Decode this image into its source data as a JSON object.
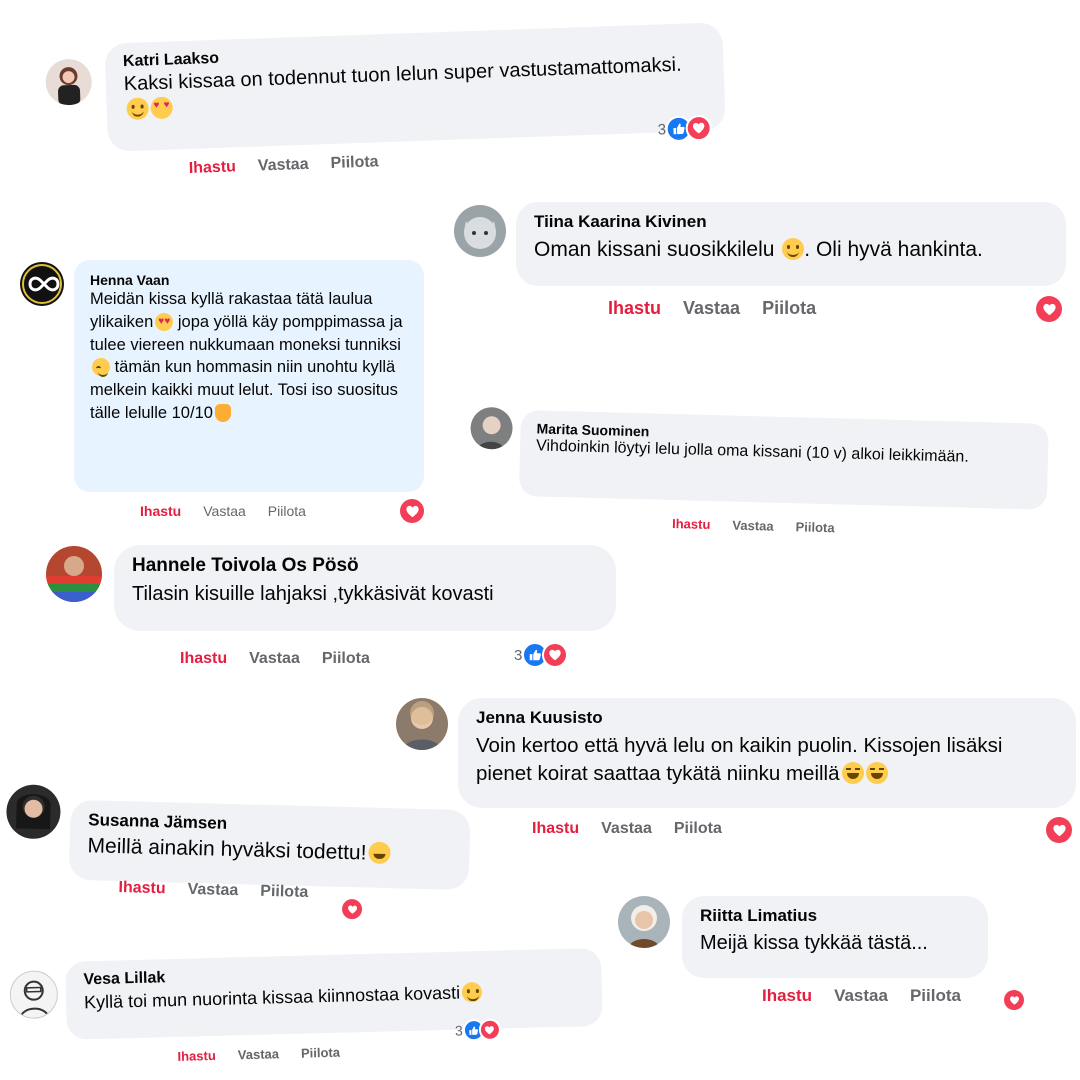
{
  "ui": {
    "like_label": "Ihastu",
    "reply_label": "Vastaa",
    "hide_label": "Piilota"
  },
  "comments": [
    {
      "author": "Katri Laakso",
      "text": "Kaksi kissaa on todennut tuon lelun super vastustamattomaksi.",
      "reaction_count": "3"
    },
    {
      "author": "Tiina Kaarina Kivinen",
      "text_before": "Oman kissani suosikkilelu",
      "text_after": ". Oli hyvä hankinta."
    },
    {
      "author": "Henna Vaan",
      "text": "Meidän kissa kyllä rakastaa tätä laulua ylikaiken",
      "text_2": " jopa yöllä käy pomppimassa ja tulee viereen nukkumaan moneksi tunniksi",
      "text_3": " tämän kun hommasin niin unohtu kyllä melkein kaikki muut lelut. Tosi iso suositus tälle lelulle 10/10"
    },
    {
      "author": "Marita Suominen",
      "text": "Vihdoinkin löytyi lelu jolla oma kissani (10 v) alkoi leikkimään."
    },
    {
      "author": "Hannele Toivola Os Pösö",
      "text": "Tilasin kisuille lahjaksi ,tykkäsivät kovasti",
      "reaction_count": "3"
    },
    {
      "author": "Jenna Kuusisto",
      "text": "Voin kertoo että hyvä lelu on kaikin puolin. Kissojen lisäksi pienet koirat saattaa tykätä niinku meillä"
    },
    {
      "author": "Susanna Jämsen",
      "text": "Meillä ainakin hyväksi todettu!"
    },
    {
      "author": "Riitta Limatius",
      "text": "Meijä kissa tykkää tästä..."
    },
    {
      "author": "Vesa Lillak",
      "text": "Kyllä toi mun nuorinta kissaa kiinnostaa kovasti",
      "reaction_count": "3"
    }
  ],
  "icons": {
    "like": "thumbs-up-icon",
    "love": "heart-icon"
  },
  "colors": {
    "bubble": "#f0f2f5",
    "bubble_highlight": "#e7f3ff",
    "like_action": "#e41e3f",
    "like_icon": "#1877f2",
    "love_icon": "#f33e58",
    "muted": "#65676b"
  }
}
